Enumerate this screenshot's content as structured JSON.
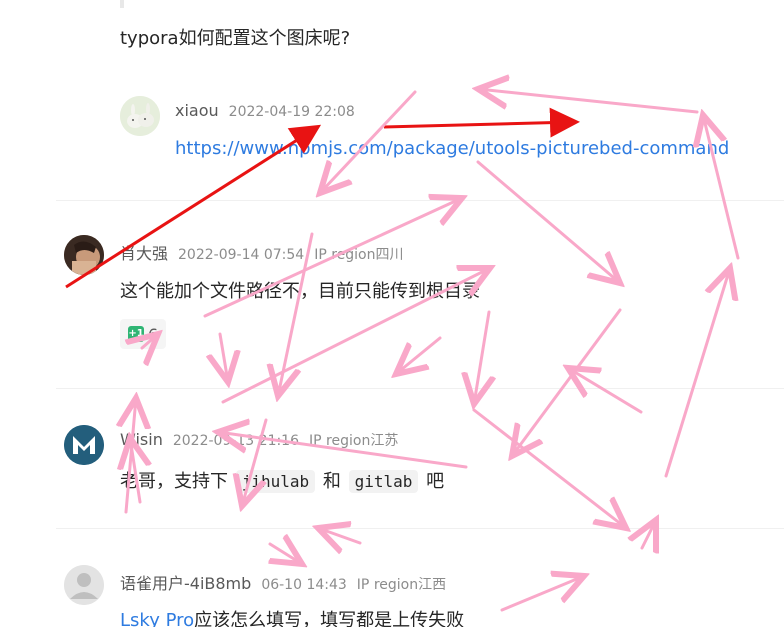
{
  "question": {
    "text": "typora如何配置这个图床呢?"
  },
  "reply": {
    "author": "xiaou",
    "time": "2022-04-19 22:08",
    "link": "https://www.npmjs.com/package/utools-picturebed-command"
  },
  "comments": [
    {
      "author": "肖大强",
      "time": "2022-09-14 07:54",
      "region": "IP region四川",
      "text": "这个能加个文件路径不，目前只能传到根目录",
      "likes": "6",
      "like_badge": "+1"
    },
    {
      "author": "Wisin",
      "time": "2022-09-13 21:16",
      "region": "IP region江苏",
      "text_before": "老哥，支持下",
      "code1": "jihulab",
      "text_mid": "和",
      "code2": "gitlab",
      "text_after": "吧",
      "avatar_letter": "M"
    },
    {
      "author": "语雀用户-4iB8mb",
      "time": "06-10 14:43",
      "region": "IP region江西",
      "link_text": "Lsky Pro",
      "text": "应该怎么填写，填写都是上传失败"
    }
  ],
  "colors": {
    "link": "#2e7be0",
    "red_arrow": "#e81313",
    "pink_arrow": "#f9a8c9"
  }
}
